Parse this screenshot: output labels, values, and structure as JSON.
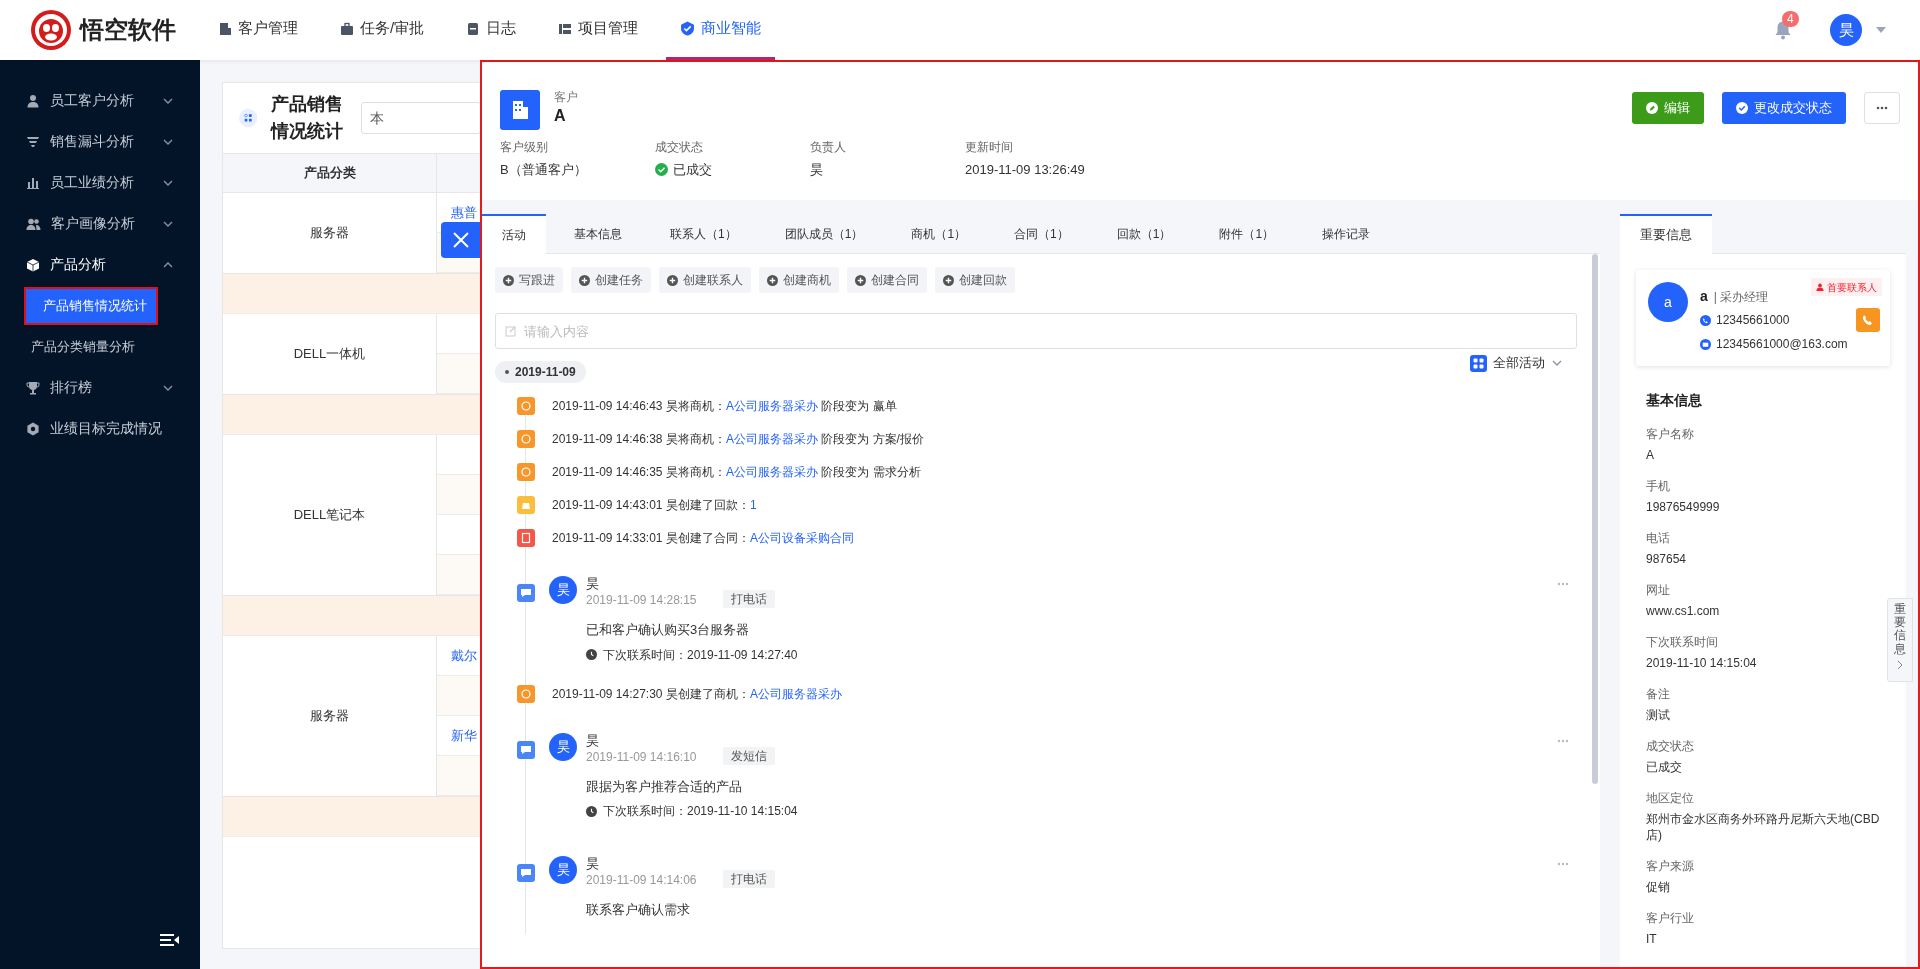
{
  "top_nav": {
    "logo_text": "悟空软件",
    "items": [
      {
        "label": "客户管理",
        "kind": "customer",
        "selected": false
      },
      {
        "label": "任务/审批",
        "kind": "task",
        "selected": false
      },
      {
        "label": "日志",
        "kind": "log",
        "selected": false
      },
      {
        "label": "项目管理",
        "kind": "project",
        "selected": false
      },
      {
        "label": "商业智能",
        "kind": "bi",
        "selected": true
      }
    ],
    "notification_count": "4",
    "user_avatar": "昊"
  },
  "sidebar": {
    "items": [
      {
        "label": "员工客户分析",
        "kind": "group",
        "expanded": false
      },
      {
        "label": "销售漏斗分析",
        "kind": "group",
        "expanded": false
      },
      {
        "label": "员工业绩分析",
        "kind": "group",
        "expanded": false
      },
      {
        "label": "客户画像分析",
        "kind": "group",
        "expanded": false
      },
      {
        "label": "产品分析",
        "kind": "group",
        "expanded": true,
        "children": [
          {
            "label": "产品销售情况统计",
            "selected": true
          },
          {
            "label": "产品分类销量分析",
            "selected": false
          }
        ]
      },
      {
        "label": "排行榜",
        "kind": "group",
        "expanded": false
      },
      {
        "label": "业绩目标完成情况",
        "kind": "link"
      }
    ]
  },
  "report": {
    "title": "产品销售情况统计",
    "filter": "本",
    "columns": [
      "产品分类"
    ],
    "groups": [
      {
        "category": "服务器",
        "rows": [
          {
            "kind": "product",
            "product": "惠普"
          },
          {
            "kind": "total"
          }
        ]
      },
      {
        "category": "DELL一体机",
        "rows": [
          {
            "kind": "product"
          },
          {
            "kind": "total"
          }
        ]
      },
      {
        "category": "DELL笔记本",
        "rows": [
          {
            "kind": "product"
          },
          {
            "kind": "total"
          },
          {
            "kind": "product"
          },
          {
            "kind": "total"
          }
        ]
      },
      {
        "category": "服务器",
        "rows": [
          {
            "kind": "product",
            "product": "戴尔"
          },
          {
            "kind": "total"
          },
          {
            "kind": "product",
            "product": "新华"
          },
          {
            "kind": "total"
          }
        ]
      }
    ]
  },
  "drawer": {
    "type_label": "客户",
    "name": "A",
    "fields": [
      {
        "label": "客户级别",
        "value": "B（普通客户）",
        "kind": "text"
      },
      {
        "label": "成交状态",
        "value": "已成交",
        "kind": "status"
      },
      {
        "label": "负责人",
        "value": "昊",
        "kind": "text"
      },
      {
        "label": "更新时间",
        "value": "2019-11-09 13:26:49",
        "kind": "text"
      }
    ],
    "buttons": [
      {
        "label": "编辑",
        "kind": "edit"
      },
      {
        "label": "更改成交状态",
        "kind": "status"
      }
    ],
    "tabs": [
      {
        "label": "活动",
        "selected": true
      },
      {
        "label": "基本信息",
        "selected": false
      },
      {
        "label": "联系人（1）",
        "selected": false
      },
      {
        "label": "团队成员（1）",
        "selected": false
      },
      {
        "label": "商机（1）",
        "selected": false
      },
      {
        "label": "合同（1）",
        "selected": false
      },
      {
        "label": "回款（1）",
        "selected": false
      },
      {
        "label": "附件（1）",
        "selected": false
      },
      {
        "label": "操作记录",
        "selected": false
      }
    ],
    "actions": [
      "写跟进",
      "创建任务",
      "创建联系人",
      "创建商机",
      "创建合同",
      "创建回款"
    ],
    "note_input": {
      "placeholder": "请输入内容"
    },
    "timeline": {
      "date": "2019-11-09",
      "filter": "全部活动",
      "entries": [
        {
          "kind": "opportunity_log",
          "color": "#f7962b",
          "text": "2019-11-09 14:46:43 昊将商机：",
          "link": "A公司服务器采办",
          "suffix": "阶段变为 赢单"
        },
        {
          "kind": "opportunity_log",
          "color": "#f7962b",
          "text": "2019-11-09 14:46:38 昊将商机：",
          "link": "A公司服务器采办",
          "suffix": "阶段变为 方案/报价"
        },
        {
          "kind": "opportunity_log",
          "color": "#f7962b",
          "text": "2019-11-09 14:46:35 昊将商机：",
          "link": "A公司服务器采办",
          "suffix": "阶段变为 需求分析"
        },
        {
          "kind": "payment_log",
          "color": "#fbbd3c",
          "text": "2019-11-09 14:43:01 昊创建了回款：",
          "link": "1"
        },
        {
          "kind": "contract_log",
          "color": "#f4574a",
          "text": "2019-11-09 14:33:01 昊创建了合同：",
          "link": "A公司设备采购合同"
        },
        {
          "kind": "followup",
          "avatar": "昊",
          "name": "昊",
          "time": "2019-11-09 14:28:15",
          "tag": "打电话",
          "content": "已和客户确认购买3台服务器",
          "next": "下次联系时间：2019-11-09 14:27:40"
        },
        {
          "kind": "opportunity_log",
          "color": "#f7962b",
          "text": "2019-11-09 14:27:30 昊创建了商机：",
          "link": "A公司服务器采办"
        },
        {
          "kind": "followup",
          "avatar": "昊",
          "name": "昊",
          "time": "2019-11-09 14:16:10",
          "tag": "发短信",
          "content": "跟据为客户推荐合适的产品",
          "next": "下次联系时间：2019-11-10 14:15:04"
        },
        {
          "kind": "followup",
          "avatar": "昊",
          "name": "昊",
          "time": "2019-11-09 14:14:06",
          "tag": "打电话",
          "content": "联系客户确认需求"
        }
      ]
    },
    "side_tabs": [
      {
        "label": "重要信息",
        "selected": true
      }
    ],
    "contact": {
      "avatar": "a",
      "name": "a",
      "title": "| 采办经理",
      "badge": "首要联系人",
      "phone": "12345661000",
      "email": "12345661000@163.com"
    },
    "basic_info": {
      "title": "基本信息",
      "fields": [
        {
          "label": "客户名称",
          "value": "A"
        },
        {
          "label": "手机",
          "value": "19876549999"
        },
        {
          "label": "电话",
          "value": "987654"
        },
        {
          "label": "网址",
          "value": "www.cs1.com"
        },
        {
          "label": "下次联系时间",
          "value": "2019-11-10 14:15:04"
        },
        {
          "label": "备注",
          "value": "测试"
        },
        {
          "label": "成交状态",
          "value": "已成交"
        },
        {
          "label": "地区定位",
          "value": "郑州市金水区商务外环路丹尼斯六天地(CBD店)"
        },
        {
          "label": "客户来源",
          "value": "促销"
        },
        {
          "label": "客户行业",
          "value": "IT"
        }
      ]
    },
    "float_tab": "重要信息"
  }
}
